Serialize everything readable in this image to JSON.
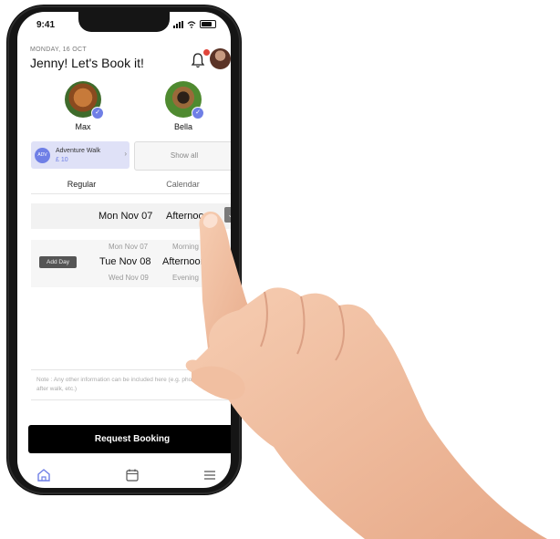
{
  "status_bar": {
    "time": "9:41"
  },
  "header": {
    "date": "MONDAY, 16 OCT",
    "greeting": "Jenny! Let's Book it!"
  },
  "pets": [
    {
      "name": "Max"
    },
    {
      "name": "Bella"
    }
  ],
  "service": {
    "icon_text": "ADV",
    "name": "Adventure  Walk",
    "price": "£ 10",
    "show_all_label": "Show all"
  },
  "tabs": [
    {
      "label": "Regular",
      "active": true
    },
    {
      "label": "Calendar",
      "active": false
    }
  ],
  "selected": {
    "date": "Mon Nov 07",
    "period": "Afternoon"
  },
  "picker": {
    "add_day_label": "Add Day",
    "dates": [
      "Mon Nov 07",
      "Tue Nov 08",
      "Wed Nov 09"
    ],
    "periods": [
      "Morning",
      "Afternoon",
      "Evening"
    ]
  },
  "notes": {
    "placeholder": "Note : Any other information can be included here (e.g. phone feed after walk, etc.)"
  },
  "request_button": {
    "label": "Request Booking"
  },
  "colors": {
    "accent": "#6f7fe6",
    "badge": "#e0453a"
  },
  "icons": [
    "bell-icon",
    "home-icon",
    "calendar-icon",
    "menu-icon"
  ]
}
